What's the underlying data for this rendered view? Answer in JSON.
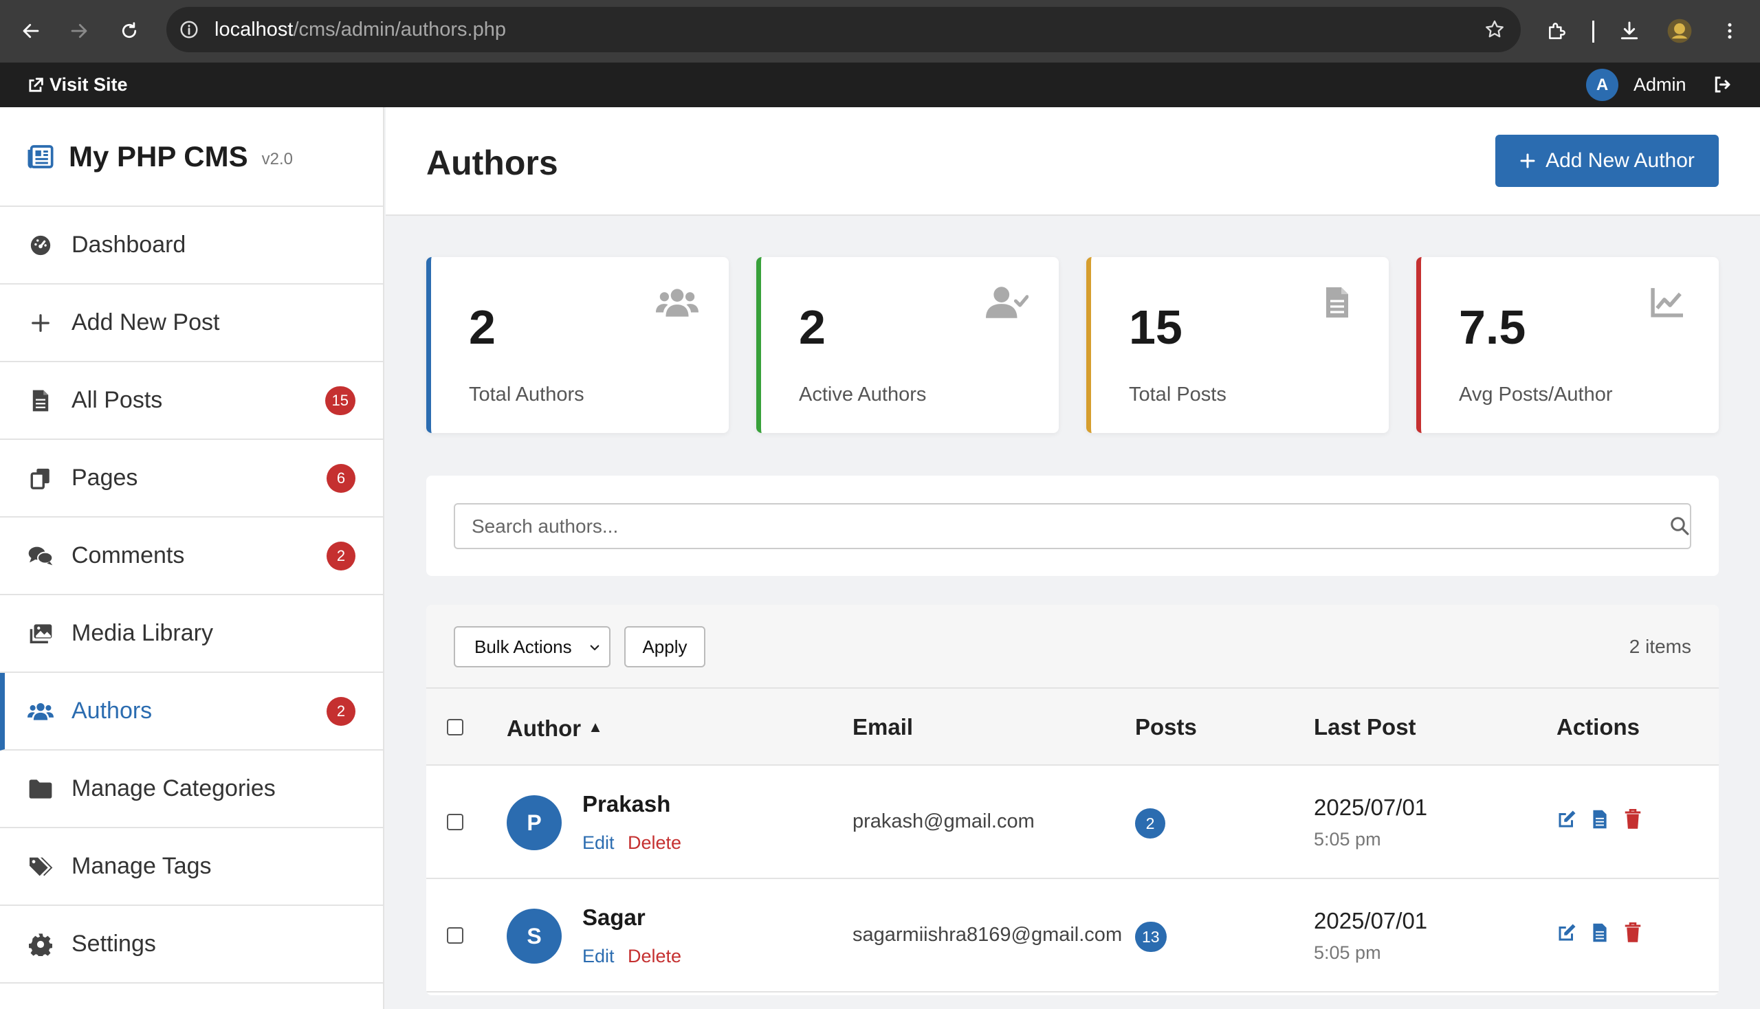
{
  "browser": {
    "url_host": "localhost",
    "url_path": "/cms/admin/authors.php"
  },
  "adminbar": {
    "visit_site": "Visit Site",
    "user_initial": "A",
    "user_name": "Admin"
  },
  "sidebar": {
    "brand_title": "My PHP CMS",
    "brand_version": "v2.0",
    "items": [
      {
        "label": "Dashboard",
        "icon": "dashboard-icon",
        "badge": ""
      },
      {
        "label": "Add New Post",
        "icon": "plus-icon",
        "badge": ""
      },
      {
        "label": "All Posts",
        "icon": "file-icon",
        "badge": "15"
      },
      {
        "label": "Pages",
        "icon": "copy-icon",
        "badge": "6"
      },
      {
        "label": "Comments",
        "icon": "comments-icon",
        "badge": "2"
      },
      {
        "label": "Media Library",
        "icon": "images-icon",
        "badge": ""
      },
      {
        "label": "Authors",
        "icon": "users-icon",
        "badge": "2",
        "active": true
      },
      {
        "label": "Manage Categories",
        "icon": "folder-icon",
        "badge": ""
      },
      {
        "label": "Manage Tags",
        "icon": "tags-icon",
        "badge": ""
      },
      {
        "label": "Settings",
        "icon": "gear-icon",
        "badge": ""
      }
    ]
  },
  "main": {
    "title": "Authors",
    "add_button": "Add New Author",
    "stats": [
      {
        "value": "2",
        "label": "Total Authors",
        "color": "#2b6cb0",
        "icon": "users-icon"
      },
      {
        "value": "2",
        "label": "Active Authors",
        "color": "#38a13a",
        "icon": "user-check-icon"
      },
      {
        "value": "15",
        "label": "Total Posts",
        "color": "#d69e2e",
        "icon": "file-icon"
      },
      {
        "value": "7.5",
        "label": "Avg Posts/Author",
        "color": "#c53030",
        "icon": "chart-line-icon"
      }
    ],
    "search_placeholder": "Search authors...",
    "bulk_actions": "Bulk Actions",
    "apply": "Apply",
    "items_count": "2 items",
    "columns": {
      "author": "Author",
      "email": "Email",
      "posts": "Posts",
      "last_post": "Last Post",
      "actions": "Actions"
    },
    "rows": [
      {
        "initial": "P",
        "name": "Prakash",
        "edit": "Edit",
        "delete": "Delete",
        "email": "prakash@gmail.com",
        "posts": "2",
        "date": "2025/07/01",
        "time": "5:05 pm"
      },
      {
        "initial": "S",
        "name": "Sagar",
        "edit": "Edit",
        "delete": "Delete",
        "email": "sagarmiishra8169@gmail.com",
        "posts": "13",
        "date": "2025/07/01",
        "time": "5:05 pm"
      }
    ]
  }
}
